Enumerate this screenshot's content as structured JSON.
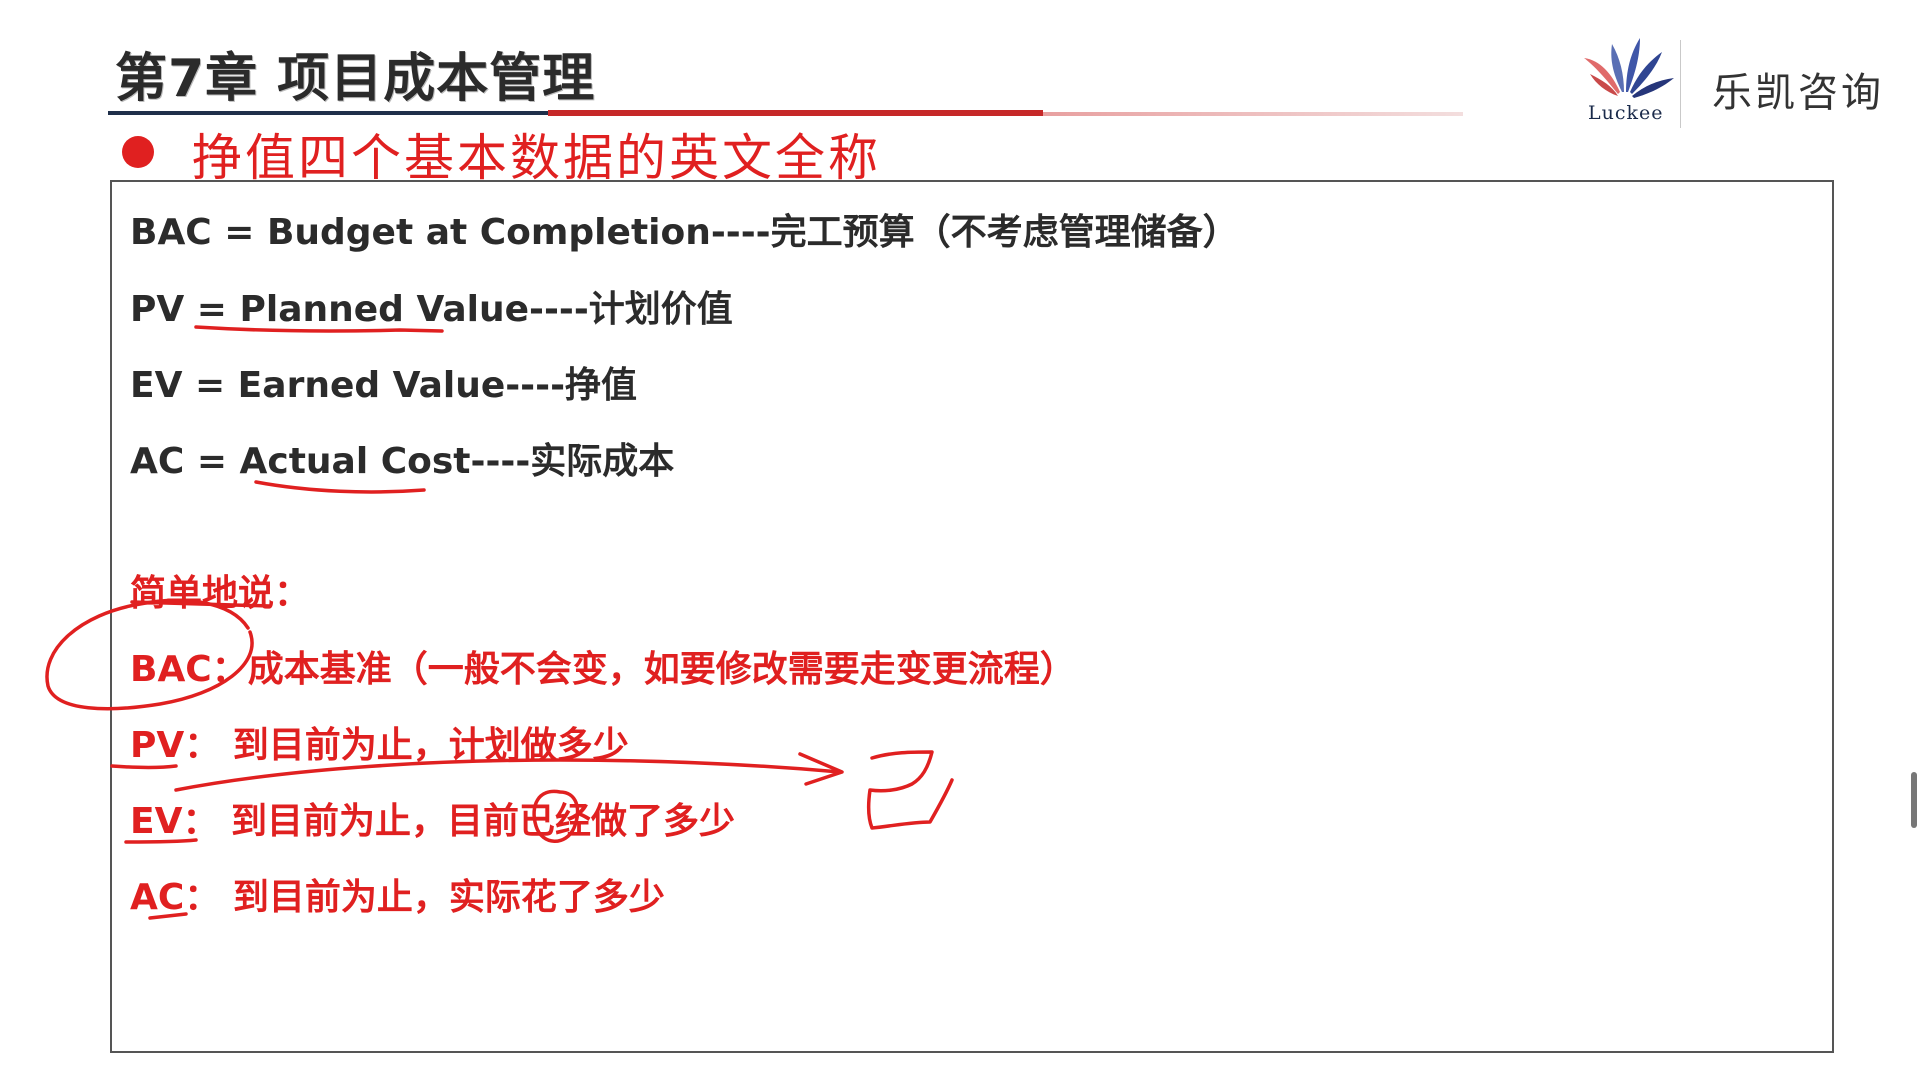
{
  "header": {
    "chapter_title": "第7章 项目成本管理",
    "subtitle": "挣值四个基本数据的英文全称"
  },
  "logo": {
    "brand_en": "Luckee",
    "brand_cn": "乐凯咨询"
  },
  "definitions": [
    "BAC = Budget at Completion----完工预算（不考虑管理储备）",
    "PV = Planned Value----计划价值",
    "EV = Earned Value----挣值",
    "AC = Actual Cost----实际成本"
  ],
  "summary": {
    "heading": "简单地说：",
    "items": [
      "BAC：成本基准（一般不会变，如要修改需要走变更流程）",
      "PV：  到目前为止，计划做多少",
      "EV：  到目前为止，目前已经做了多少",
      "AC：  到目前为止，实际花了多少"
    ]
  },
  "annotations": {
    "handwritten_char": "已"
  },
  "colors": {
    "accent_red": "#e02020",
    "text_dark": "#2b2b2b",
    "rule_navy": "#1f2f4a"
  }
}
